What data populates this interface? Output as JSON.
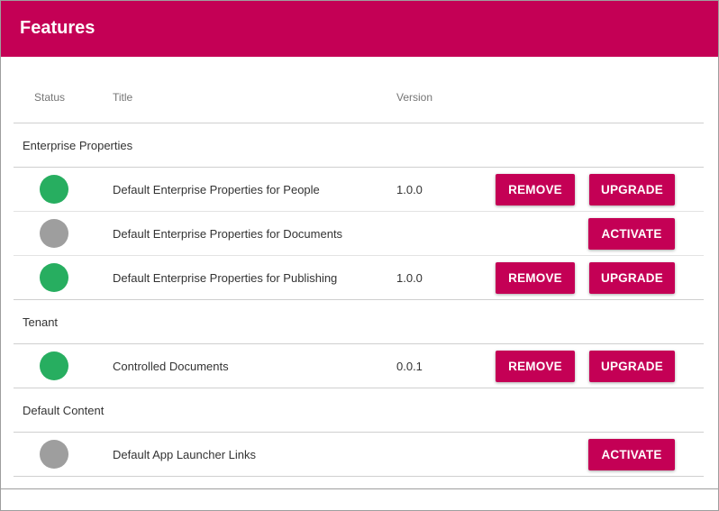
{
  "header": {
    "title": "Features"
  },
  "columns": {
    "status": "Status",
    "title": "Title",
    "version": "Version"
  },
  "colors": {
    "brand": "#c40055",
    "status_active": "#27ae60",
    "status_inactive": "#9e9e9e"
  },
  "groups": [
    {
      "name": "Enterprise Properties",
      "features": [
        {
          "title": "Default Enterprise Properties for People",
          "version": "1.0.0",
          "status": "active",
          "actions": [
            "REMOVE",
            "UPGRADE"
          ]
        },
        {
          "title": "Default Enterprise Properties for Documents",
          "version": "",
          "status": "inactive",
          "actions": [
            "ACTIVATE"
          ]
        },
        {
          "title": "Default Enterprise Properties for Publishing",
          "version": "1.0.0",
          "status": "active",
          "actions": [
            "REMOVE",
            "UPGRADE"
          ]
        }
      ]
    },
    {
      "name": "Tenant",
      "features": [
        {
          "title": "Controlled Documents",
          "version": "0.0.1",
          "status": "active",
          "actions": [
            "REMOVE",
            "UPGRADE"
          ]
        }
      ]
    },
    {
      "name": "Default Content",
      "features": [
        {
          "title": "Default App Launcher Links",
          "version": "",
          "status": "inactive",
          "actions": [
            "ACTIVATE"
          ]
        }
      ]
    }
  ]
}
